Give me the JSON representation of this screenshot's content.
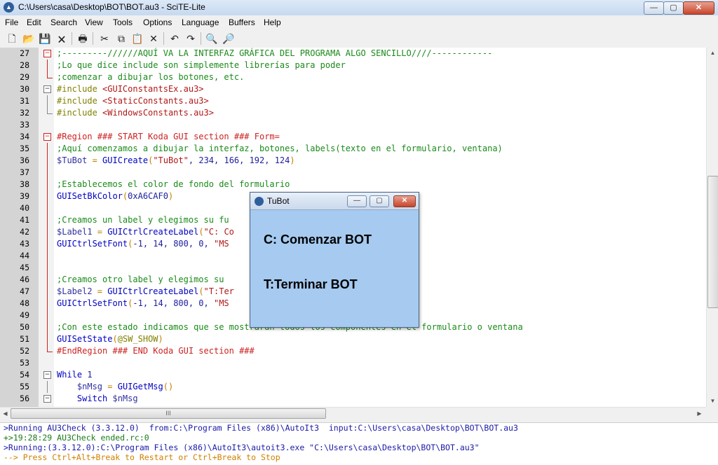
{
  "window": {
    "title": "C:\\Users\\casa\\Desktop\\BOT\\BOT.au3 - SciTE-Lite",
    "minimize": "—",
    "maximize": "▢",
    "close": "✕"
  },
  "menu": [
    "File",
    "Edit",
    "Search",
    "View",
    "Tools",
    "Options",
    "Language",
    "Buffers",
    "Help"
  ],
  "toolbar": {
    "new_icon": "🗋",
    "open_icon": "📂",
    "save_icon": "💾",
    "close_icon": "🗙",
    "print_icon": "🖶",
    "cut_icon": "✂",
    "copy_icon": "⧉",
    "paste_icon": "📋",
    "delete_icon": "✕",
    "undo_icon": "↶",
    "redo_icon": "↷",
    "find_icon": "🔍",
    "replace_icon": "🔎"
  },
  "colors": {
    "comment": "#1a8a1a",
    "keyword": "#0000c0",
    "function": "#0000c0",
    "string": "#b01818",
    "variable": "#3030a0",
    "number": "#2020a0",
    "operator": "#c08000",
    "directive": "#808000",
    "region": "#cc2222",
    "gui_bg": "#a6caf0"
  },
  "lines": [
    {
      "n": "27",
      "fold": "box-red",
      "segs": [
        {
          "t": ";---------//////AQUÍ VA LA INTERFAZ GRÁFICA DEL PROGRAMA ALGO SENCILLO////------------",
          "c": "comment"
        }
      ]
    },
    {
      "n": "28",
      "fold": "line-red",
      "segs": [
        {
          "t": ";Lo que dice include son simplemente librerías para poder",
          "c": "comment"
        }
      ]
    },
    {
      "n": "29",
      "fold": "end-red",
      "segs": [
        {
          "t": ";comenzar a dibujar los botones, etc.",
          "c": "comment"
        }
      ]
    },
    {
      "n": "30",
      "fold": "box",
      "segs": [
        {
          "t": "#include ",
          "c": "directive"
        },
        {
          "t": "<GUIConstantsEx.au3>",
          "c": "string"
        }
      ]
    },
    {
      "n": "31",
      "fold": "line",
      "segs": [
        {
          "t": "#include ",
          "c": "directive"
        },
        {
          "t": "<StaticConstants.au3>",
          "c": "string"
        }
      ]
    },
    {
      "n": "32",
      "fold": "end",
      "segs": [
        {
          "t": "#include ",
          "c": "directive"
        },
        {
          "t": "<WindowsConstants.au3>",
          "c": "string"
        }
      ]
    },
    {
      "n": "33",
      "fold": "",
      "segs": []
    },
    {
      "n": "34",
      "fold": "box-red",
      "segs": [
        {
          "t": "#Region ### START Koda GUI section ### Form=",
          "c": "region"
        }
      ]
    },
    {
      "n": "35",
      "fold": "line-red",
      "segs": [
        {
          "t": ";Aquí comenzamos a dibujar la interfaz, botones, labels(texto en el formulario, ventana)",
          "c": "comment"
        }
      ]
    },
    {
      "n": "36",
      "fold": "line-red",
      "segs": [
        {
          "t": "$TuBot",
          "c": "variable"
        },
        {
          "t": " = ",
          "c": "operator"
        },
        {
          "t": "GUICreate",
          "c": "function"
        },
        {
          "t": "(",
          "c": "operator"
        },
        {
          "t": "\"TuBot\"",
          "c": "string"
        },
        {
          "t": ", 234, 166, 192, 124",
          "c": "number"
        },
        {
          "t": ")",
          "c": "operator"
        }
      ]
    },
    {
      "n": "37",
      "fold": "line-red",
      "segs": []
    },
    {
      "n": "38",
      "fold": "line-red",
      "segs": [
        {
          "t": ";Establecemos el color de fondo del formulario",
          "c": "comment"
        }
      ]
    },
    {
      "n": "39",
      "fold": "line-red",
      "segs": [
        {
          "t": "GUISetBkColor",
          "c": "function"
        },
        {
          "t": "(",
          "c": "operator"
        },
        {
          "t": "0xA6CAF0",
          "c": "number"
        },
        {
          "t": ")",
          "c": "operator"
        }
      ]
    },
    {
      "n": "40",
      "fold": "line-red",
      "segs": []
    },
    {
      "n": "41",
      "fold": "line-red",
      "segs": [
        {
          "t": ";Creamos un label y elegimos su fu",
          "c": "comment"
        }
      ]
    },
    {
      "n": "42",
      "fold": "line-red",
      "segs": [
        {
          "t": "$Label1",
          "c": "variable"
        },
        {
          "t": " = ",
          "c": "operator"
        },
        {
          "t": "GUICtrlCreateLabel",
          "c": "function"
        },
        {
          "t": "(",
          "c": "operator"
        },
        {
          "t": "\"C: Co",
          "c": "string"
        }
      ]
    },
    {
      "n": "43",
      "fold": "line-red",
      "segs": [
        {
          "t": "GUICtrlSetFont",
          "c": "function"
        },
        {
          "t": "(",
          "c": "operator"
        },
        {
          "t": "-1, 14, 800, 0, ",
          "c": "number"
        },
        {
          "t": "\"MS",
          "c": "string"
        }
      ]
    },
    {
      "n": "44",
      "fold": "line-red",
      "segs": []
    },
    {
      "n": "45",
      "fold": "line-red",
      "segs": []
    },
    {
      "n": "46",
      "fold": "line-red",
      "segs": [
        {
          "t": ";Creamos otro label y elegimos su ",
          "c": "comment"
        }
      ]
    },
    {
      "n": "47",
      "fold": "line-red",
      "segs": [
        {
          "t": "$Label2",
          "c": "variable"
        },
        {
          "t": " = ",
          "c": "operator"
        },
        {
          "t": "GUICtrlCreateLabel",
          "c": "function"
        },
        {
          "t": "(",
          "c": "operator"
        },
        {
          "t": "\"T:Ter",
          "c": "string"
        }
      ]
    },
    {
      "n": "48",
      "fold": "line-red",
      "segs": [
        {
          "t": "GUICtrlSetFont",
          "c": "function"
        },
        {
          "t": "(",
          "c": "operator"
        },
        {
          "t": "-1, 14, 800, 0, ",
          "c": "number"
        },
        {
          "t": "\"MS",
          "c": "string"
        }
      ]
    },
    {
      "n": "49",
      "fold": "line-red",
      "segs": []
    },
    {
      "n": "50",
      "fold": "line-red",
      "segs": [
        {
          "t": ";Con este estado indicamos que se mostrarán todos los componentes en el formulario o ventana",
          "c": "comment"
        }
      ]
    },
    {
      "n": "51",
      "fold": "line-red",
      "segs": [
        {
          "t": "GUISetState",
          "c": "function"
        },
        {
          "t": "(",
          "c": "operator"
        },
        {
          "t": "@SW_SHOW",
          "c": "directive"
        },
        {
          "t": ")",
          "c": "operator"
        }
      ]
    },
    {
      "n": "52",
      "fold": "end-red",
      "segs": [
        {
          "t": "#EndRegion ### END Koda GUI section ###",
          "c": "region"
        }
      ]
    },
    {
      "n": "53",
      "fold": "",
      "segs": []
    },
    {
      "n": "54",
      "fold": "box",
      "segs": [
        {
          "t": "While",
          "c": "keyword"
        },
        {
          "t": " 1",
          "c": "number"
        }
      ]
    },
    {
      "n": "55",
      "fold": "line",
      "segs": [
        {
          "t": "    $nMsg",
          "c": "variable"
        },
        {
          "t": " = ",
          "c": "operator"
        },
        {
          "t": "GUIGetMsg",
          "c": "function"
        },
        {
          "t": "()",
          "c": "operator"
        }
      ]
    },
    {
      "n": "56",
      "fold": "box",
      "segs": [
        {
          "t": "    Switch",
          "c": "keyword"
        },
        {
          "t": " $nMsg",
          "c": "variable"
        }
      ]
    }
  ],
  "output": [
    {
      "t": ">Running AU3Check (3.3.12.0)  from:C:\\Program Files (x86)\\AutoIt3  input:C:\\Users\\casa\\Desktop\\BOT\\BOT.au3",
      "c": "#1a1aa8"
    },
    {
      "t": "+>19:28:29 AU3Check ended.rc:0",
      "c": "#1a7a1a"
    },
    {
      "t": ">Running:(3.3.12.0):C:\\Program Files (x86)\\AutoIt3\\autoit3.exe \"C:\\Users\\casa\\Desktop\\BOT\\BOT.au3\"",
      "c": "#1a1aa8"
    },
    {
      "t": "--> Press Ctrl+Alt+Break to Restart or Ctrl+Break to Stop",
      "c": "#d08000"
    }
  ],
  "scroll": {
    "h_thumb_glyph": "III",
    "up": "▲",
    "down": "▼",
    "left": "◀",
    "right": "▶"
  },
  "tubot": {
    "title": "TuBot",
    "label1": "C: Comenzar BOT",
    "label2": "T:Terminar BOT",
    "minimize": "—",
    "maximize": "▢",
    "close": "✕"
  }
}
